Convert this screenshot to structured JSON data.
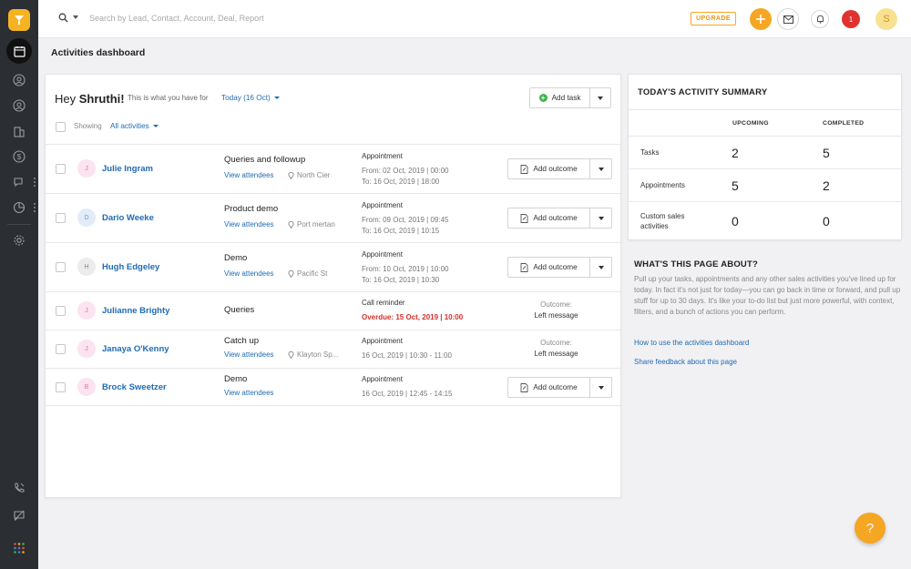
{
  "topbar": {
    "search_placeholder": "Search by Lead, Contact, Account, Deal, Report",
    "upgrade_label": "UPGRADE",
    "notification_count": "1",
    "user_initial": "S"
  },
  "page": {
    "title": "Activities dashboard"
  },
  "main": {
    "greeting_prefix": "Hey",
    "greeting_name": "Shruthi!",
    "greeting_sub": "This is what you have for",
    "date_filter": "Today (16 Oct)",
    "showing_label": "Showing",
    "filter_label": "All activities",
    "add_task_label": "Add task",
    "rows": [
      {
        "initial": "J",
        "name": "Julie Ingram",
        "subject": "Queries and followup",
        "attendees": "View attendees",
        "location": "North Cier",
        "type": "Appointment",
        "line1": "From: 02 Oct, 2019 | 00:00",
        "line2": "To: 16 Oct, 2019 | 18:00",
        "outcome_button": "Add outcome"
      },
      {
        "initial": "D",
        "name": "Dario Weeke",
        "subject": "Product demo",
        "attendees": "View attendees",
        "location": "Port mertan",
        "type": "Appointment",
        "line1": "From: 09 Oct, 2019 | 09:45",
        "line2": "To: 16 Oct, 2019 | 10:15",
        "outcome_button": "Add outcome"
      },
      {
        "initial": "H",
        "name": "Hugh Edgeley",
        "subject": "Demo",
        "attendees": "View attendees",
        "location": "Pacific St",
        "type": "Appointment",
        "line1": "From: 10 Oct, 2019 | 10:00",
        "line2": "To: 16 Oct, 2019 | 10:30",
        "outcome_button": "Add outcome"
      },
      {
        "initial": "J",
        "name": "Julianne Brighty",
        "subject": "Queries",
        "type": "Call reminder",
        "line1": "Overdue: 15 Oct, 2019 | 10:00",
        "outcome_label": "Outcome:",
        "outcome_value": "Left message"
      },
      {
        "initial": "J",
        "name": "Janaya O'Kenny",
        "subject": "Catch up",
        "attendees": "View attendees",
        "location": "Klayton Sp...",
        "type": "Appointment",
        "line1": "16 Oct, 2019 | 10:30 - 11:00",
        "outcome_label": "Outcome:",
        "outcome_value": "Left message"
      },
      {
        "initial": "B",
        "name": "Brock Sweetzer",
        "subject": "Demo",
        "attendees": "View attendees",
        "type": "Appointment",
        "line1": "16 Oct, 2019 | 12:45 - 14:15",
        "outcome_button": "Add outcome"
      }
    ]
  },
  "summary": {
    "title": "TODAY'S ACTIVITY SUMMARY",
    "col_upcoming": "UPCOMING",
    "col_completed": "COMPLETED",
    "rows": [
      {
        "label": "Tasks",
        "upcoming": "2",
        "completed": "5"
      },
      {
        "label": "Appointments",
        "upcoming": "5",
        "completed": "2"
      },
      {
        "label": "Custom sales activities",
        "upcoming": "0",
        "completed": "0"
      }
    ]
  },
  "about": {
    "title": "WHAT'S THIS PAGE ABOUT?",
    "text": "Pull up your tasks, appointments and any other sales activities you've lined up for today. In fact it's not just for today—you can go back in time or forward, and pull up stuff for up to 30 days. It's like your to-do list but just more powerful, with context, filters, and a bunch of actions you can perform.",
    "link1": "How to use the activities dashboard",
    "link2": "Share feedback about this page"
  },
  "help": {
    "label": "?"
  },
  "colors": {
    "accent": "#f5a623",
    "link": "#1f6bb3",
    "overdue": "#d0312d",
    "sidebar": "#2b2e33"
  }
}
